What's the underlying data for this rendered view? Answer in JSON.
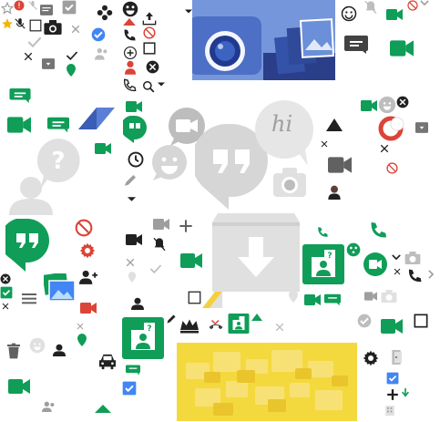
{
  "sheet": {
    "kind": "icon-sprite-sheet",
    "hi_bubble_text": "hi"
  },
  "colors": {
    "hangouts_green": "#0f9d58",
    "bubble_grey": "#d6d6d6",
    "dark_icon": "#212121",
    "mid_grey": "#9e9e9e",
    "red": "#db4437",
    "blue": "#4285f4",
    "yellow": "#f4d03f",
    "photo_blue": "#5b7fd6"
  },
  "icons": [
    "star-outline-icon",
    "alert-icon",
    "mic-off-icon",
    "checkbox-blank-icon",
    "checkbox-checked-icon",
    "message-icon",
    "flower-icon",
    "smiley-icon",
    "arrow-down-icon",
    "photo-banner-icon",
    "notifications-off-icon",
    "video-icon",
    "block-icon",
    "chevron-down-icon",
    "star-filled-icon",
    "mic-off-icon-2",
    "camera-icon",
    "close-icon",
    "check-circle-icon",
    "phone-icon",
    "upload-icon",
    "chat-bubble-icon",
    "video-call-icon",
    "hangouts-logo-icon",
    "help-bubble-icon",
    "person-silhouette-icon",
    "clock-icon",
    "pencil-icon",
    "hi-bubble-icon",
    "emoji-bubble-icon",
    "camera-bubble-icon",
    "archive-icon",
    "triangle-icon",
    "block-red-icon",
    "hangouts-green-logo",
    "settings-icon",
    "photos-icon",
    "person-add-icon",
    "menu-icon",
    "add-icon",
    "avatar-card-icon",
    "crown-icon",
    "missed-call-icon",
    "trash-icon",
    "car-icon",
    "group-icon",
    "yellow-chat-banner",
    "exit-icon",
    "phone-green-icon"
  ]
}
